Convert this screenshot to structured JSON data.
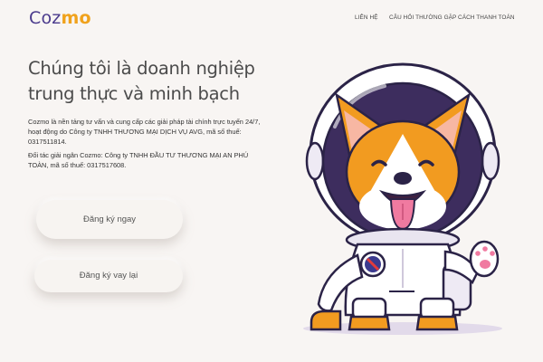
{
  "brand": {
    "logo_part1": "Coz",
    "logo_part2": "mo",
    "colors": {
      "primary": "#4a3a8c",
      "accent": "#f0a21c"
    }
  },
  "nav": {
    "items": [
      {
        "label": "LIÊN HỆ"
      },
      {
        "label": "CÂU HỎI THƯỜNG GẶP"
      },
      {
        "label": "CÁCH THANH TOÁN"
      }
    ]
  },
  "hero": {
    "headline_line1": "Chúng tôi là doanh nghiệp",
    "headline_line2": "trung thực và minh bạch",
    "paragraph1": "Cozmo là nền tảng tư vấn và cung cấp các giải pháp tài chính trực tuyến 24/7, hoạt động do Công ty TNHH THƯƠNG MẠI DỊCH VỤ AVG, mã số thuế: 0317511814.",
    "paragraph2": "Đối tác giải ngân Cozmo: Công ty TNHH ĐẦU TƯ THƯƠNG MẠI AN PHÚ TOÀN, mã số thuế: 0317517608.",
    "register_button": "Đăng ký ngay",
    "loan_button": "Đăng ký vay lại"
  },
  "illustration": {
    "icon": "corgi-astronaut-illustration"
  }
}
